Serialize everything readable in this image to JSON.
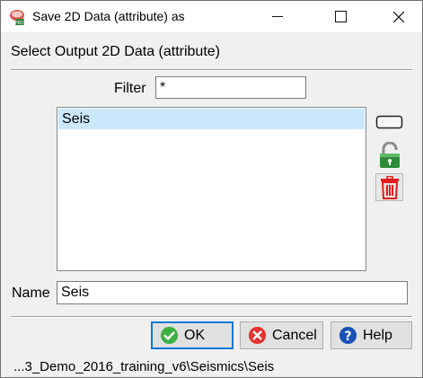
{
  "window": {
    "title": "Save 2D Data (attribute) as",
    "app_icon": "od-pro-icon",
    "controls": {
      "minimize": "minimize-icon",
      "maximize": "maximize-icon",
      "close": "close-icon"
    }
  },
  "heading": "Select Output 2D Data (attribute)",
  "filter": {
    "label": "Filter",
    "value": "*"
  },
  "list": {
    "items": [
      "Seis"
    ],
    "selected_index": 0,
    "selected_bg": "#cce8ff"
  },
  "side_buttons": [
    {
      "icon": "rename-icon"
    },
    {
      "icon": "unlock-icon"
    },
    {
      "icon": "trash-icon"
    }
  ],
  "name": {
    "label": "Name",
    "value": "Seis"
  },
  "buttons": {
    "ok": {
      "label": "OK",
      "icon": "check-icon",
      "color": "#3cb043"
    },
    "cancel": {
      "label": "Cancel",
      "icon": "cancel-icon",
      "color": "#e5322c"
    },
    "help": {
      "label": "Help",
      "icon": "help-icon",
      "color": "#1a52b8"
    }
  },
  "status": "...3_Demo_2016_training_v6\\Seismics\\Seis",
  "colors": {
    "focus_border": "#0078d7",
    "dialog_bg": "#f0f0f0"
  }
}
